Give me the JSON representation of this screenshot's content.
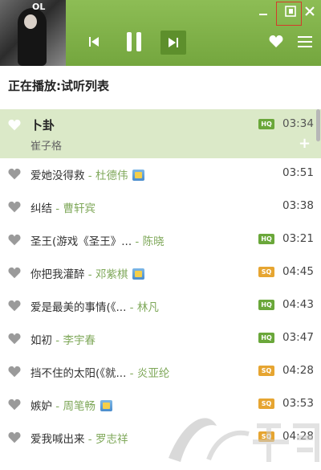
{
  "window": {
    "cover_text": "OL"
  },
  "controls": {
    "prev": "prev-icon",
    "pause": "pause-icon",
    "next": "next-icon",
    "minimize": "minimize-icon",
    "mini_mode": "mini-mode-icon",
    "close": "close-icon",
    "favorite": "heart-icon",
    "menu": "menu-icon"
  },
  "playlist": {
    "title": "正在播放:试听列表"
  },
  "songs": [
    {
      "title": "卜卦",
      "artist": "崔子格",
      "quality": "HQ",
      "duration": "03:34",
      "active": true,
      "vip": false
    },
    {
      "title": "爱她没得救",
      "artist": "杜德伟",
      "quality": "",
      "duration": "03:51",
      "active": false,
      "vip": true
    },
    {
      "title": "纠结",
      "artist": "曹轩宾",
      "quality": "",
      "duration": "03:38",
      "active": false,
      "vip": false
    },
    {
      "title": "圣王(游戏《圣王》...",
      "artist": "陈晓",
      "quality": "HQ",
      "duration": "03:21",
      "active": false,
      "vip": false
    },
    {
      "title": "你把我灌醉",
      "artist": "邓紫棋",
      "quality": "SQ",
      "duration": "04:45",
      "active": false,
      "vip": true
    },
    {
      "title": "爱是最美的事情(《...",
      "artist": "林凡",
      "quality": "HQ",
      "duration": "04:43",
      "active": false,
      "vip": false
    },
    {
      "title": "如初",
      "artist": "李宇春",
      "quality": "HQ",
      "duration": "03:47",
      "active": false,
      "vip": false
    },
    {
      "title": "挡不住的太阳(《就...",
      "artist": "炎亚纶",
      "quality": "SQ",
      "duration": "04:28",
      "active": false,
      "vip": false
    },
    {
      "title": "嫉妒",
      "artist": "周笔畅",
      "quality": "SQ",
      "duration": "03:53",
      "active": false,
      "vip": true
    },
    {
      "title": "爱我喊出来",
      "artist": "罗志祥",
      "quality": "SQ",
      "duration": "04:28",
      "active": false,
      "vip": false
    }
  ],
  "colors": {
    "header": "#7aaa44",
    "active_row": "#dbe9c8",
    "hq": "#6aa73a",
    "sq": "#e6a531"
  }
}
